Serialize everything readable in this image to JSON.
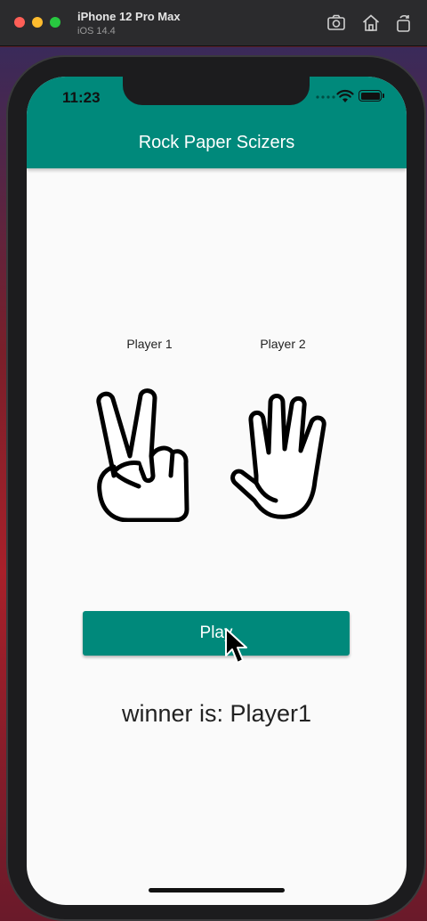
{
  "simulator": {
    "device_name": "iPhone 12 Pro Max",
    "os_version": "iOS 14.4",
    "toolbar_icons": [
      "screenshot-icon",
      "home-icon",
      "rotate-icon"
    ]
  },
  "status_bar": {
    "time": "11:23",
    "icons": [
      "signal-dots-icon",
      "wifi-icon",
      "battery-icon"
    ]
  },
  "app": {
    "title": "Rock Paper Scizers",
    "accent_color": "#00897b",
    "player1": {
      "label": "Player 1",
      "choice_icon": "scissors-hand-icon"
    },
    "player2": {
      "label": "Player 2",
      "choice_icon": "paper-hand-icon"
    },
    "play_button_label": "Play",
    "winner_text": "winner is: Player1"
  }
}
